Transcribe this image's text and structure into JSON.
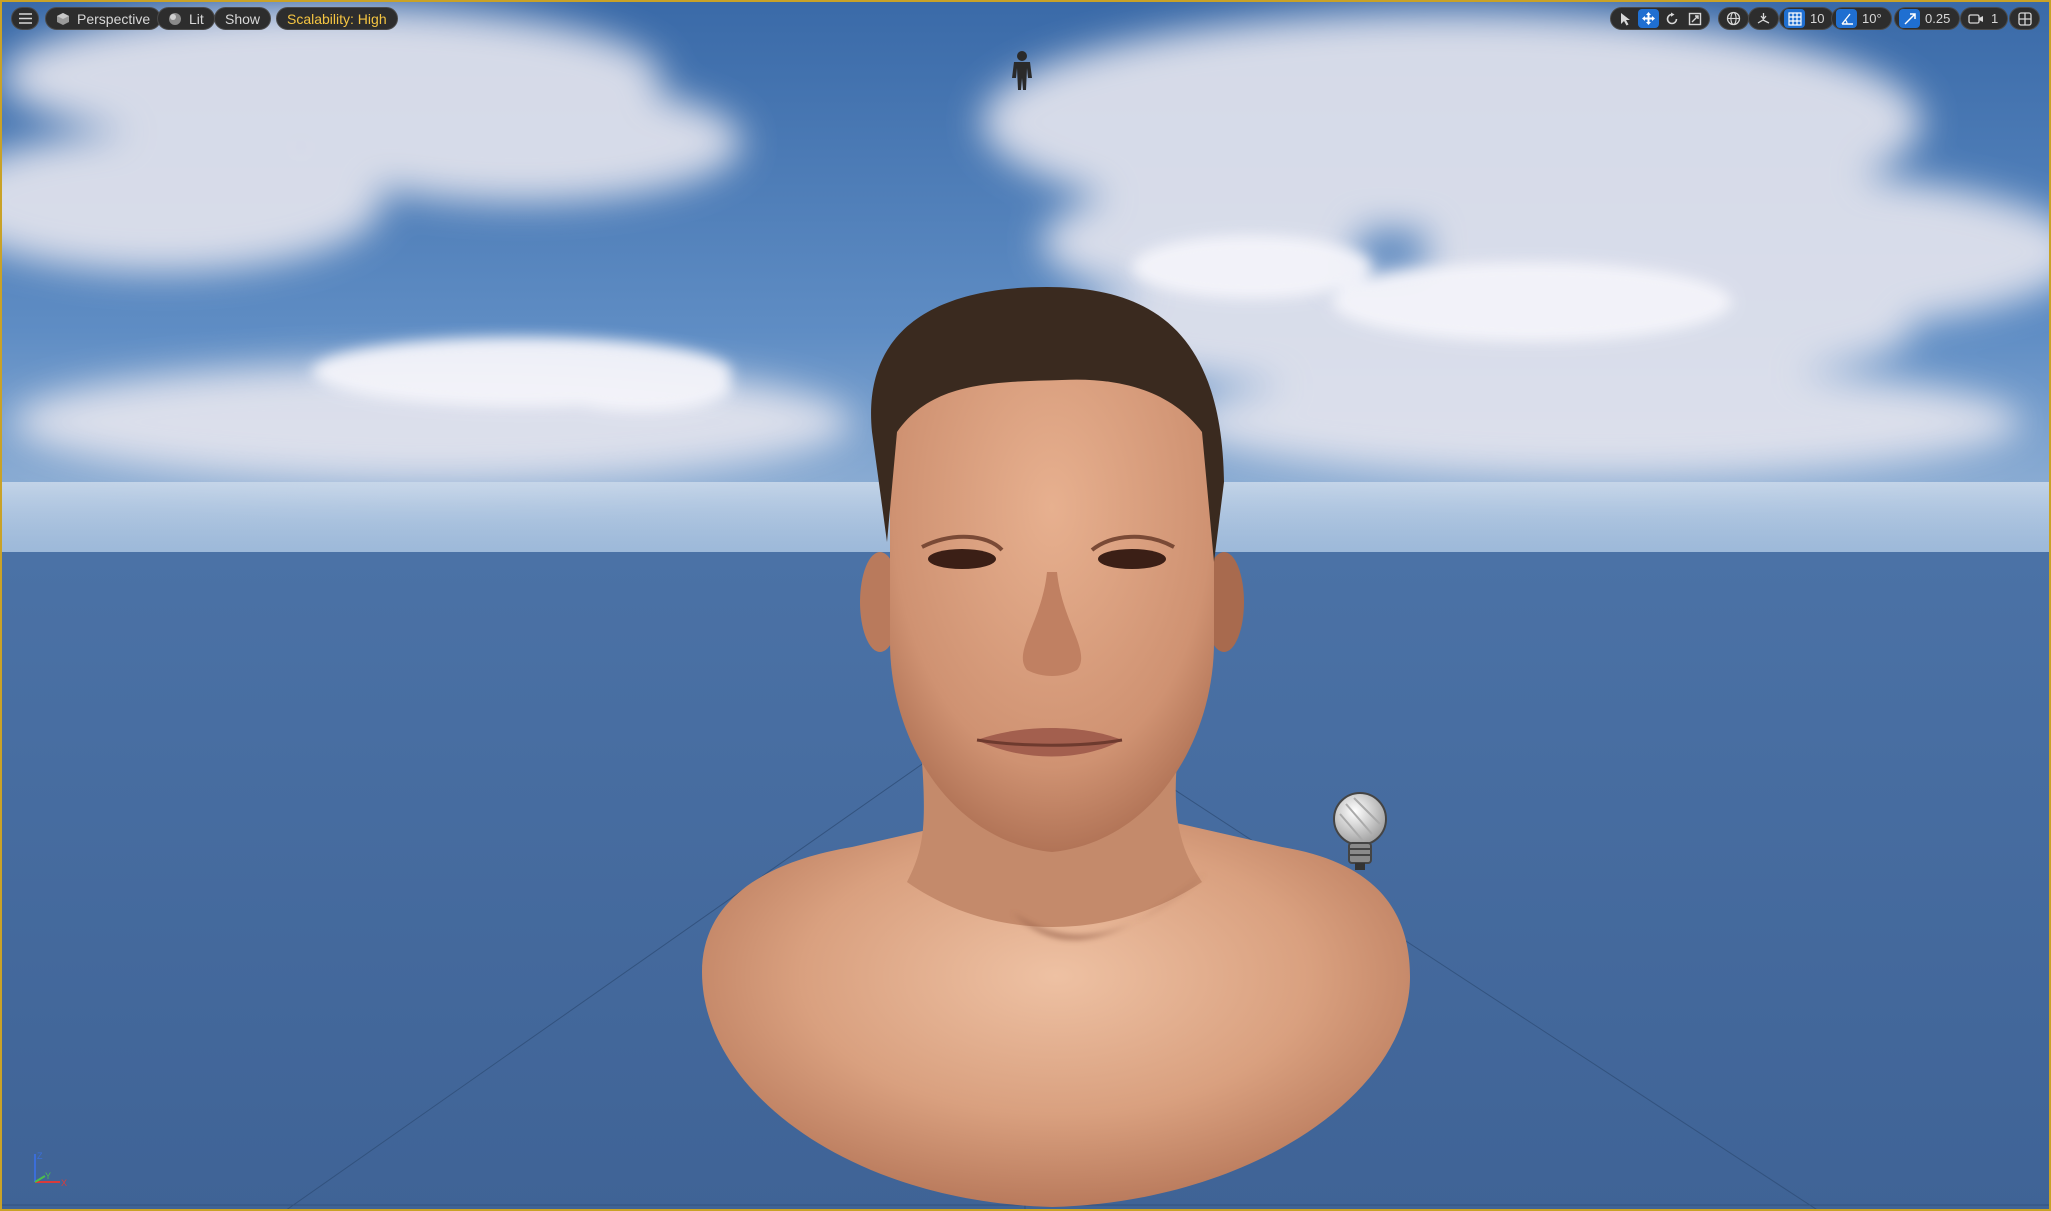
{
  "viewport_toolbar": {
    "menu_icon": "hamburger-icon",
    "view_mode": {
      "icon": "perspective-cube-icon",
      "label": "Perspective"
    },
    "lighting": {
      "icon": "lit-sphere-icon",
      "label": "Lit"
    },
    "show_label": "Show",
    "scalability_label": "Scalability: High",
    "scalability_color": "#f5c542"
  },
  "transform_tools": {
    "select_icon": "select-arrow-icon",
    "translate_icon": "translate-icon",
    "rotate_icon": "rotate-icon",
    "scale_icon": "scale-icon",
    "active_tool": "translate"
  },
  "coordinate_space_icon": "world-globe-icon",
  "surface_snap_icon": "surface-snap-icon",
  "grid_snap": {
    "icon": "grid-snap-icon",
    "value": "10"
  },
  "rotation_snap": {
    "icon": "angle-snap-icon",
    "value": "10°"
  },
  "scale_snap": {
    "icon": "scale-snap-icon",
    "value": "0.25"
  },
  "camera_speed": {
    "icon": "camera-icon",
    "value": "1"
  },
  "layout_icon": "viewport-layout-icon",
  "scene": {
    "sky": "blue sky with clouds",
    "character_icon": "character-figure-icon",
    "light_icon": "point-light-bulb-icon",
    "axis_indicator": {
      "x": "X",
      "y": "Y",
      "z": "Z"
    }
  },
  "colors": {
    "toolbar_bg": "#2d2d2d",
    "toolbar_text": "#d8d8d8",
    "active_blue": "#1f6fd1",
    "viewport_border": "#c9a227",
    "ground": "#44679a"
  }
}
